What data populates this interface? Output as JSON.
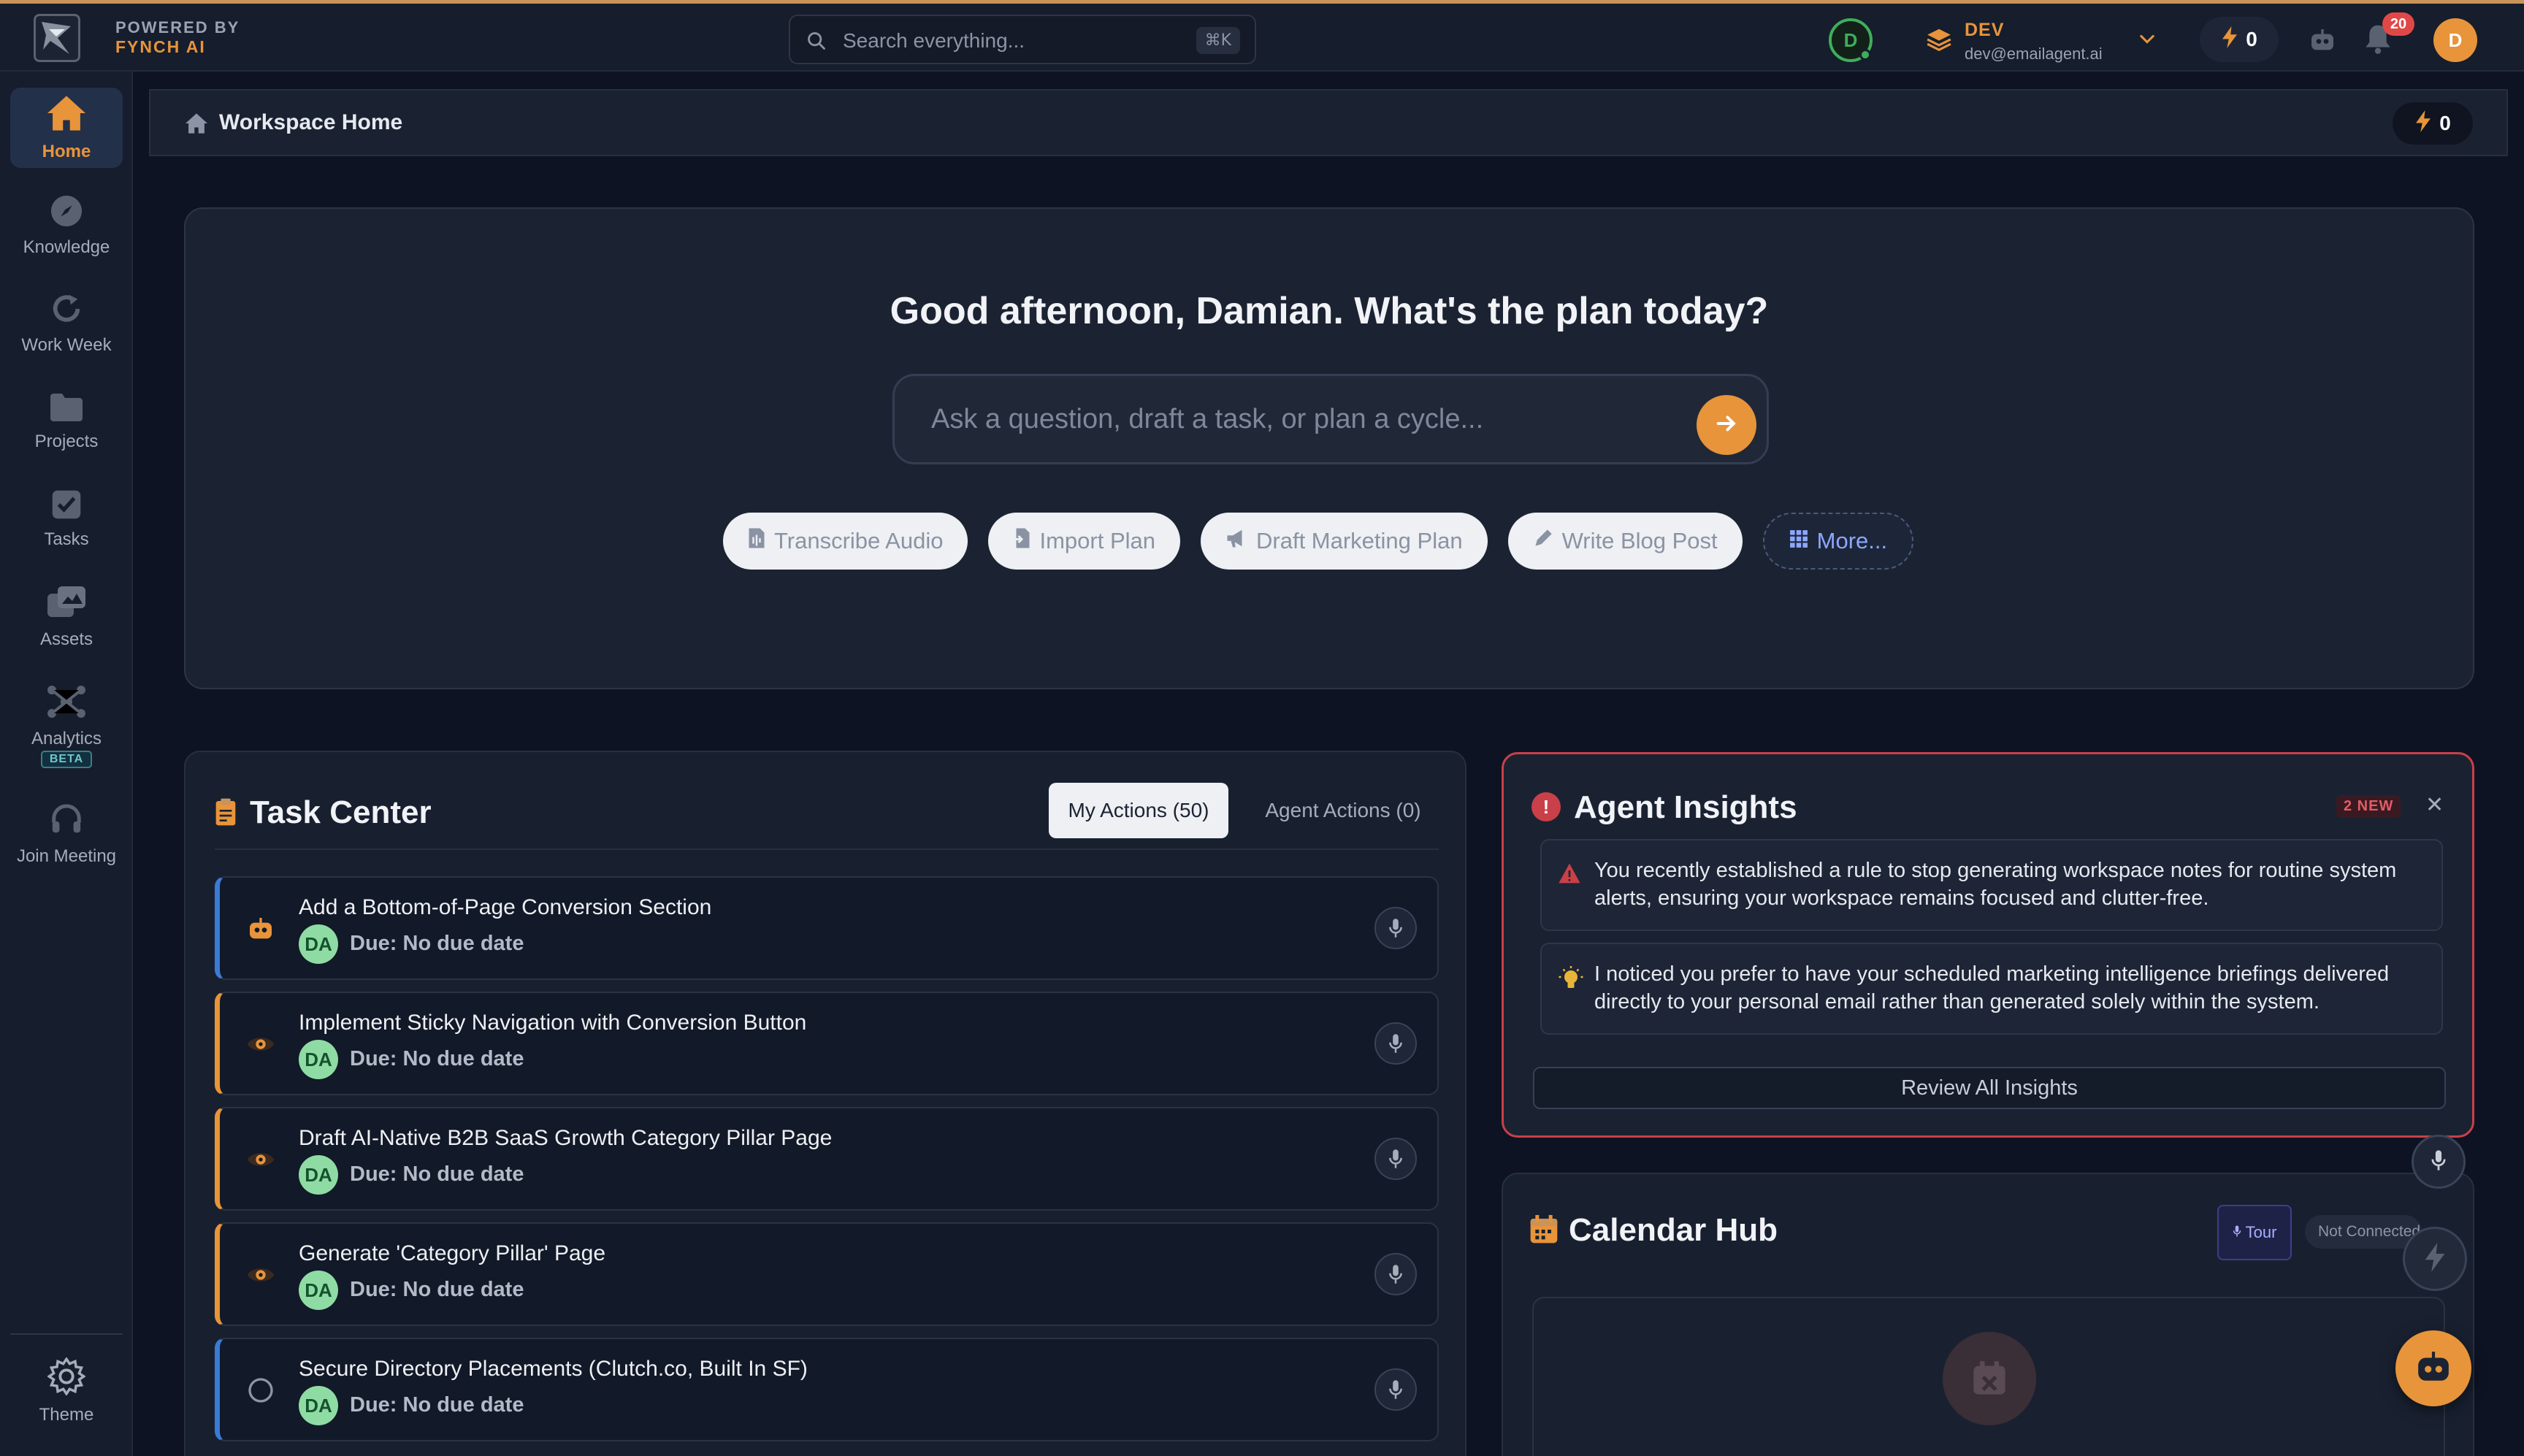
{
  "colors": {
    "accent": "#e8943a",
    "background": "#0d1322",
    "panel": "#182030",
    "danger": "#c94048",
    "online": "#3fae5a",
    "task_blue": "#3a7bd5",
    "task_orange": "#e8943a"
  },
  "brand": {
    "powered_by": "POWERED BY",
    "name": "FYNCH AI",
    "logo_icon": "bird-logo-icon"
  },
  "search": {
    "placeholder": "Search everything...",
    "shortcut": "⌘K"
  },
  "header": {
    "status_avatar": "D",
    "workspace_name": "DEV",
    "workspace_email": "dev@emailagent.ai",
    "credits": "0",
    "notification_count": "20",
    "user_avatar": "D"
  },
  "sidebar": {
    "items": [
      {
        "label": "Home",
        "icon": "home-icon",
        "active": true
      },
      {
        "label": "Knowledge",
        "icon": "compass-icon"
      },
      {
        "label": "Work Week",
        "icon": "refresh-icon"
      },
      {
        "label": "Projects",
        "icon": "folder-icon"
      },
      {
        "label": "Tasks",
        "icon": "checkbox-icon"
      },
      {
        "label": "Assets",
        "icon": "images-icon"
      },
      {
        "label": "Analytics",
        "icon": "network-icon",
        "badge": "BETA"
      },
      {
        "label": "Join Meeting",
        "icon": "headset-icon"
      }
    ],
    "theme_label": "Theme"
  },
  "breadcrumb": {
    "label": "Workspace Home",
    "credits": "0"
  },
  "hero": {
    "greeting": "Good afternoon, Damian. What's the plan today?",
    "input_placeholder": "Ask a question, draft a task, or plan a cycle...",
    "chips": [
      {
        "label": "Transcribe Audio",
        "icon": "file-audio-icon"
      },
      {
        "label": "Import Plan",
        "icon": "file-import-icon"
      },
      {
        "label": "Draft Marketing Plan",
        "icon": "megaphone-icon"
      },
      {
        "label": "Write Blog Post",
        "icon": "pen-icon"
      },
      {
        "label": "More...",
        "icon": "grid-icon"
      }
    ]
  },
  "task_center": {
    "title": "Task Center",
    "tab_my_actions": "My Actions (50)",
    "tab_agent_actions": "Agent Actions (0)",
    "tasks": [
      {
        "title": "Add a Bottom-of-Page Conversion Section",
        "assignee": "DA",
        "due": "Due: No due date",
        "status_icon": "robot-icon",
        "accent": "blue"
      },
      {
        "title": "Implement Sticky Navigation with Conversion Button",
        "assignee": "DA",
        "due": "Due: No due date",
        "status_icon": "eye-icon",
        "accent": "orange"
      },
      {
        "title": "Draft AI-Native B2B SaaS Growth Category Pillar Page",
        "assignee": "DA",
        "due": "Due: No due date",
        "status_icon": "eye-icon",
        "accent": "orange"
      },
      {
        "title": "Generate 'Category Pillar' Page",
        "assignee": "DA",
        "due": "Due: No due date",
        "status_icon": "eye-icon",
        "accent": "orange"
      },
      {
        "title": "Secure Directory Placements (Clutch.co, Built In SF)",
        "assignee": "DA",
        "due": "Due: No due date",
        "status_icon": "circle-icon",
        "accent": "blue"
      }
    ]
  },
  "insights": {
    "title": "Agent Insights",
    "badge": "2 NEW",
    "items": [
      {
        "text": "You recently established a rule to stop generating workspace notes for routine system alerts, ensuring your workspace remains focused and clutter-free.",
        "icon": "warning-icon"
      },
      {
        "text": "I noticed you prefer to have your scheduled marketing intelligence briefings delivered directly to your personal email rather than generated solely within the system.",
        "icon": "lightbulb-icon"
      }
    ],
    "review_label": "Review All Insights"
  },
  "calendar": {
    "title": "Calendar Hub",
    "tour_label": "Tour",
    "status_label": "Not Connected"
  }
}
